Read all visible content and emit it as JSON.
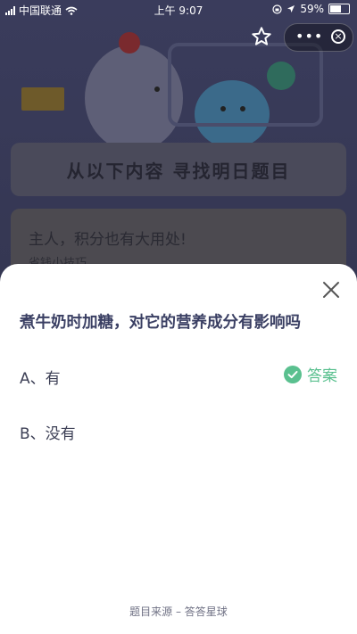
{
  "status_bar": {
    "carrier": "中国联通",
    "time": "上午 9:07",
    "battery": "59%"
  },
  "background": {
    "banner_title": "从以下内容 寻找明日题目",
    "promo_title": "主人，积分也有大用处!",
    "promo_subtitle": "省钱小技巧"
  },
  "quiz": {
    "question": "煮牛奶时加糖，对它的营养成分有影响吗",
    "options": [
      {
        "label": "A、有",
        "is_answer": true
      },
      {
        "label": "B、没有",
        "is_answer": false
      }
    ],
    "answer_label": "答案",
    "source": "题目来源 – 答答星球"
  },
  "colors": {
    "accent_green": "#5ac08f",
    "question_text": "#3a3f63"
  }
}
